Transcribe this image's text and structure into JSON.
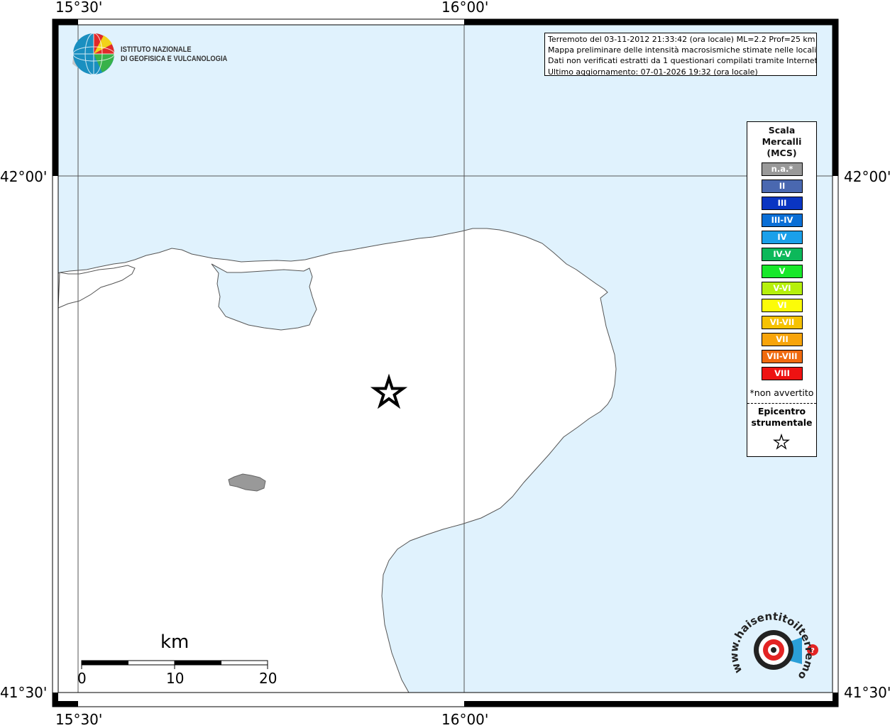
{
  "coords": {
    "top_left": "15°30'",
    "top_right": "16°00'",
    "bottom_left": "15°30'",
    "bottom_right": "16°00'",
    "left_upper": "42°00'",
    "left_lower": "41°30'",
    "right_upper": "42°00'",
    "right_lower": "41°30'"
  },
  "info": {
    "line1": "Terremoto del 03-11-2012 21:33:42 (ora locale) ML=2.2 Prof=25 km",
    "line2": "Mappa preliminare delle intensità macrosismiche stimate nelle località",
    "line3": "Dati non verificati estratti da 1 questionari compilati tramite Internet.",
    "line4": "Ultimo aggiornamento: 07-01-2026 19:32 (ora locale)"
  },
  "logo": {
    "line1": "ISTITUTO NAZIONALE",
    "line2": "DI GEOFISICA E VULCANOLOGIA"
  },
  "legend": {
    "title1": "Scala",
    "title2": "Mercalli",
    "title3": "(MCS)",
    "items": [
      {
        "label": "n.a.*",
        "color": "#999999"
      },
      {
        "label": "II",
        "color": "#4a68b0"
      },
      {
        "label": "III",
        "color": "#0a35c2"
      },
      {
        "label": "III-IV",
        "color": "#0a6fd6"
      },
      {
        "label": "IV",
        "color": "#1aa0ea"
      },
      {
        "label": "IV-V",
        "color": "#0cb85a"
      },
      {
        "label": "V",
        "color": "#18e82a"
      },
      {
        "label": "V-VI",
        "color": "#b6f00c"
      },
      {
        "label": "VI",
        "color": "#fcfc08"
      },
      {
        "label": "VI-VII",
        "color": "#f6c202"
      },
      {
        "label": "VII",
        "color": "#f8a40a"
      },
      {
        "label": "VII-VIII",
        "color": "#f06a0e"
      },
      {
        "label": "VIII",
        "color": "#ee1212"
      }
    ],
    "note": "*non avvertito",
    "epi1": "Epicentro",
    "epi2": "strumentale"
  },
  "scale": {
    "unit": "km",
    "labels": [
      "0",
      "10",
      "20"
    ]
  },
  "watermark": "www.haisentitoilterremoto.it",
  "colors": {
    "sea": "#e0f2fd",
    "land": "#ffffff",
    "coast": "#555555",
    "lake": "#999999"
  }
}
